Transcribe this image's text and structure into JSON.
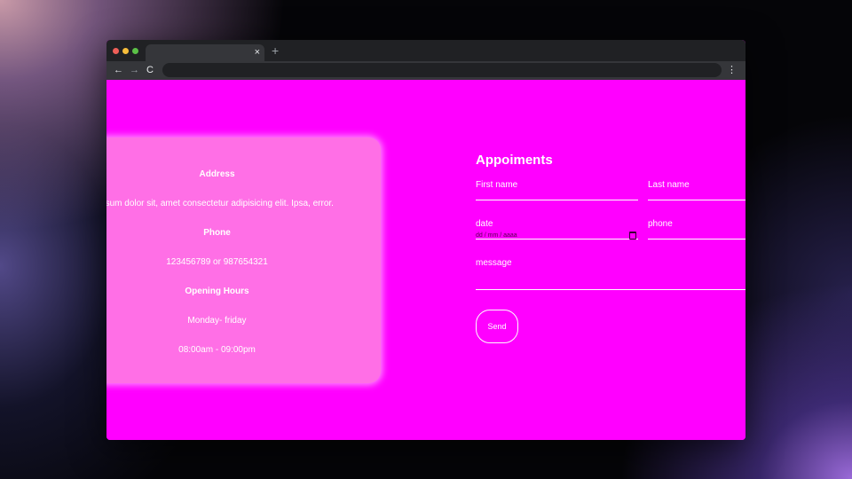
{
  "browser": {
    "tab_close": "×",
    "new_tab": "+",
    "back": "←",
    "forward": "→",
    "reload": "C",
    "menu": "⋮"
  },
  "contact_card": {
    "address_heading": "Address",
    "address_text": "psum dolor sit, amet consectetur adipisicing elit. Ipsa, error.",
    "phone_heading": "Phone",
    "phone_text": "123456789 or 987654321",
    "hours_heading": "Opening Hours",
    "hours_days": "Monday- friday",
    "hours_time": "08:00am - 09:00pm"
  },
  "form": {
    "title": "Appoiments",
    "first_name_label": "First name",
    "last_name_label": "Last name",
    "date_label": "date",
    "date_placeholder": "dd / mm / aaaa",
    "phone_label": "phone",
    "message_label": "message",
    "send_label": "Send"
  },
  "colors": {
    "page_background": "#ff00ff",
    "card_background": "#ff6fe6",
    "text": "#ffffff"
  }
}
